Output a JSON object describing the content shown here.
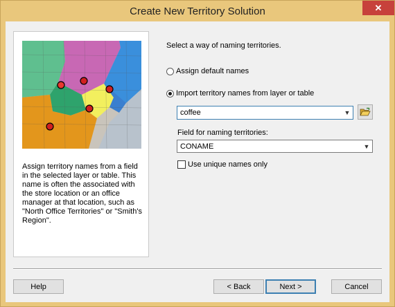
{
  "window": {
    "title": "Create New Territory Solution",
    "close_glyph": "✕"
  },
  "left_panel": {
    "description": "Assign territory names from a field in the selected layer or table. This name is often the associated with the store location or an office manager at that location, such as \"North Office Territories\" or \"Smith's Region\"."
  },
  "main": {
    "prompt": "Select a way of naming territories.",
    "option_default": "Assign default names",
    "option_import": "Import territory names from layer or table",
    "layer_value": "coffee",
    "field_label": "Field for naming territories:",
    "field_value": "CONAME",
    "unique_label": "Use unique names only"
  },
  "buttons": {
    "help": "Help",
    "back": "< Back",
    "next": "Next >",
    "cancel": "Cancel"
  },
  "colors": {
    "title_bar": "#e9c77c",
    "close_button": "#c7413b",
    "dialog_bg": "#f0f0f0",
    "default_button_border": "#3c7fb1"
  }
}
